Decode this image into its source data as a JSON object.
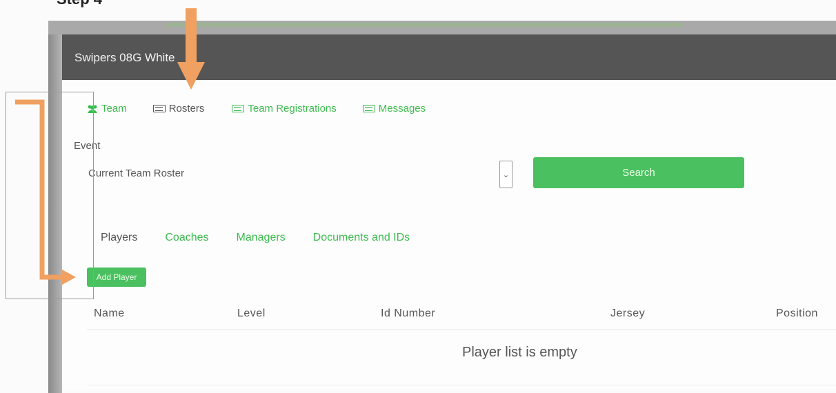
{
  "step_label": "Step 4",
  "header": {
    "title": "Swipers 08G White"
  },
  "nav": {
    "items": [
      {
        "label": "Team",
        "icon": "team-icon",
        "active": false
      },
      {
        "label": "Rosters",
        "icon": "id-card-icon",
        "active": true
      },
      {
        "label": "Team Registrations",
        "icon": "id-card-icon",
        "active": false
      },
      {
        "label": "Messages",
        "icon": "id-card-icon",
        "active": false
      }
    ]
  },
  "event": {
    "label": "Event",
    "selected": "Current Team Roster",
    "search_label": "Search"
  },
  "subtabs": {
    "items": [
      {
        "label": "Players",
        "active": true
      },
      {
        "label": "Coaches",
        "active": false
      },
      {
        "label": "Managers",
        "active": false
      },
      {
        "label": "Documents and IDs",
        "active": false
      }
    ]
  },
  "add_player_label": "Add Player",
  "table": {
    "columns": [
      "Name",
      "Level",
      "Id Number",
      "Jersey",
      "Position"
    ],
    "empty_message": "Player list is empty"
  },
  "colors": {
    "accent_green": "#4bc060",
    "link_green": "#3dbb4f",
    "header_bg": "#555555",
    "annotation_arrow": "#f0a060"
  }
}
